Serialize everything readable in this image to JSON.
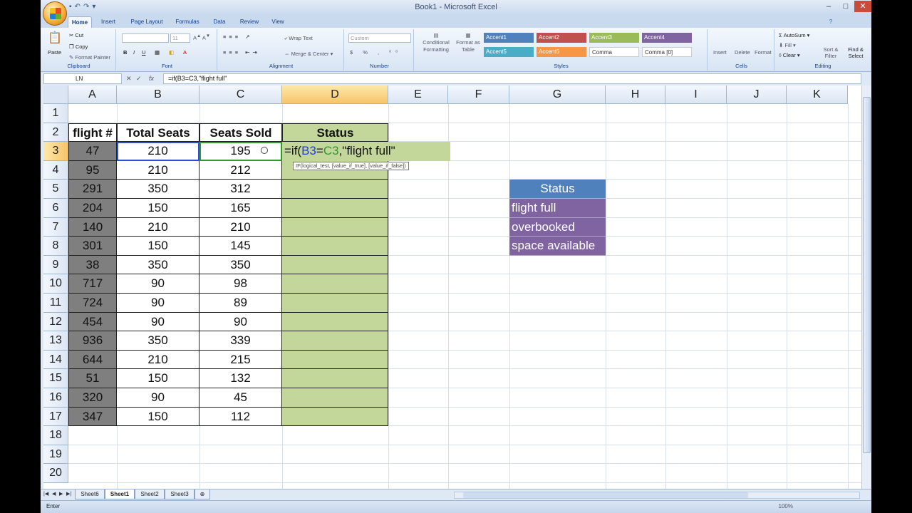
{
  "window": {
    "title": "Book1 - Microsoft Excel",
    "minimize": "–",
    "maximize": "□",
    "close": "✕"
  },
  "tabs": [
    "Home",
    "Insert",
    "Page Layout",
    "Formulas",
    "Data",
    "Review",
    "View"
  ],
  "ribbon": {
    "clipboard": {
      "paste": "Paste",
      "cut": "Cut",
      "copy": "Copy",
      "format_painter": "Format Painter",
      "label": "Clipboard"
    },
    "font": {
      "size": "11",
      "label": "Font"
    },
    "alignment": {
      "wrap_text": "Wrap Text",
      "merge": "Merge & Center",
      "label": "Alignment"
    },
    "number": {
      "format": "Custom",
      "label": "Number"
    },
    "styles": {
      "conditional": "Conditional Formatting",
      "format_table": "Format as Table",
      "cells": [
        "Accent1",
        "Accent2",
        "Accent3",
        "Accent4",
        "Accent5",
        "Accent6",
        "Comma",
        "Comma [0]"
      ],
      "label": "Styles"
    },
    "cells": {
      "insert": "Insert",
      "delete": "Delete",
      "format": "Format",
      "label": "Cells"
    },
    "editing": {
      "autosum": "AutoSum",
      "fill": "Fill",
      "clear": "Clear",
      "sort": "Sort & Filter",
      "find": "Find & Select",
      "label": "Editing"
    }
  },
  "formula_bar": {
    "name_box": "LN",
    "formula": "=if(B3=C3,\"flight full\""
  },
  "columns": [
    "A",
    "B",
    "C",
    "D",
    "E",
    "F",
    "G",
    "H",
    "I",
    "J",
    "K"
  ],
  "rows": [
    "1",
    "2",
    "3",
    "4",
    "5",
    "6",
    "7",
    "8",
    "9",
    "10",
    "11",
    "12",
    "13",
    "14",
    "15",
    "16",
    "17",
    "18",
    "19",
    "20"
  ],
  "table": {
    "headers": [
      "flight #",
      "Total Seats",
      "Seats Sold",
      "Status"
    ],
    "rows": [
      [
        "47",
        "210",
        "195"
      ],
      [
        "95",
        "210",
        "212"
      ],
      [
        "291",
        "350",
        "312"
      ],
      [
        "204",
        "150",
        "165"
      ],
      [
        "140",
        "210",
        "210"
      ],
      [
        "301",
        "150",
        "145"
      ],
      [
        "38",
        "350",
        "350"
      ],
      [
        "717",
        "90",
        "98"
      ],
      [
        "724",
        "90",
        "89"
      ],
      [
        "454",
        "90",
        "90"
      ],
      [
        "936",
        "350",
        "339"
      ],
      [
        "644",
        "210",
        "215"
      ],
      [
        "51",
        "150",
        "132"
      ],
      [
        "320",
        "90",
        "45"
      ],
      [
        "347",
        "150",
        "112"
      ]
    ]
  },
  "editing_cell": {
    "prefix": "=if(",
    "ref1": "B3",
    "eq": "=",
    "ref2": "C3",
    "suffix": ",\"flight full\""
  },
  "tooltip": "IF(logical_test, [value_if_true], [value_if_false])",
  "status_list": {
    "header": "Status",
    "items": [
      "flight full",
      "overbooked",
      "space available"
    ]
  },
  "sheets": [
    "Sheet6",
    "Sheet1",
    "Sheet2",
    "Sheet3"
  ],
  "active_sheet": "Sheet1",
  "status_bar": {
    "mode": "Enter",
    "zoom": "100%"
  },
  "colors": {
    "status_header": "#4f81bd",
    "status_item": "#8064a2",
    "status_column": "#c4d79b",
    "flight_column": "#7f7f7f"
  }
}
